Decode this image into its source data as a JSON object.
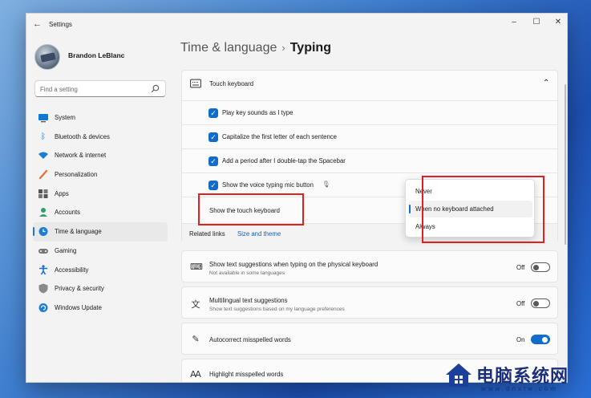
{
  "window": {
    "title": "Settings"
  },
  "profile": {
    "name": "Brandon LeBlanc"
  },
  "search": {
    "placeholder": "Find a setting"
  },
  "sidebar": {
    "items": [
      {
        "label": "System",
        "icon": "monitor-icon"
      },
      {
        "label": "Bluetooth & devices",
        "icon": "bluetooth-icon"
      },
      {
        "label": "Network & internet",
        "icon": "wifi-icon"
      },
      {
        "label": "Personalization",
        "icon": "brush-icon"
      },
      {
        "label": "Apps",
        "icon": "apps-icon"
      },
      {
        "label": "Accounts",
        "icon": "person-icon"
      },
      {
        "label": "Time & language",
        "icon": "globe-clock-icon",
        "active": true
      },
      {
        "label": "Gaming",
        "icon": "gamepad-icon"
      },
      {
        "label": "Accessibility",
        "icon": "accessibility-icon"
      },
      {
        "label": "Privacy & security",
        "icon": "shield-icon"
      },
      {
        "label": "Windows Update",
        "icon": "update-icon"
      }
    ]
  },
  "breadcrumb": {
    "parent": "Time & language",
    "separator": "›",
    "current": "Typing"
  },
  "touch_keyboard": {
    "header": "Touch keyboard",
    "options": [
      {
        "label": "Play key sounds as I type",
        "checked": true
      },
      {
        "label": "Capitalize the first letter of each sentence",
        "checked": true
      },
      {
        "label": "Add a period after I double-tap the Spacebar",
        "checked": true
      },
      {
        "label": "Show the voice typing mic button",
        "checked": true
      }
    ],
    "show_label": "Show the touch keyboard"
  },
  "related": {
    "label": "Related links",
    "link": "Size and theme"
  },
  "dropdown": {
    "options": [
      "Never",
      "When no keyboard attached",
      "Always"
    ],
    "selected": "When no keyboard attached"
  },
  "settings": [
    {
      "title": "Show text suggestions when typing on the physical keyboard",
      "subtitle": "Not available in some languages",
      "state": "Off",
      "on": false
    },
    {
      "title": "Multilingual text suggestions",
      "subtitle": "Show text suggestions based on my language preferences",
      "state": "Off",
      "on": false
    },
    {
      "title": "Autocorrect misspelled words",
      "state": "On",
      "on": true
    },
    {
      "title": "Highlight misspelled words"
    }
  ],
  "watermark": {
    "text": "电脑系统网",
    "url": "www.dnxtw.com"
  },
  "colors": {
    "accent": "#0f6ccb",
    "highlight": "#e02020"
  }
}
